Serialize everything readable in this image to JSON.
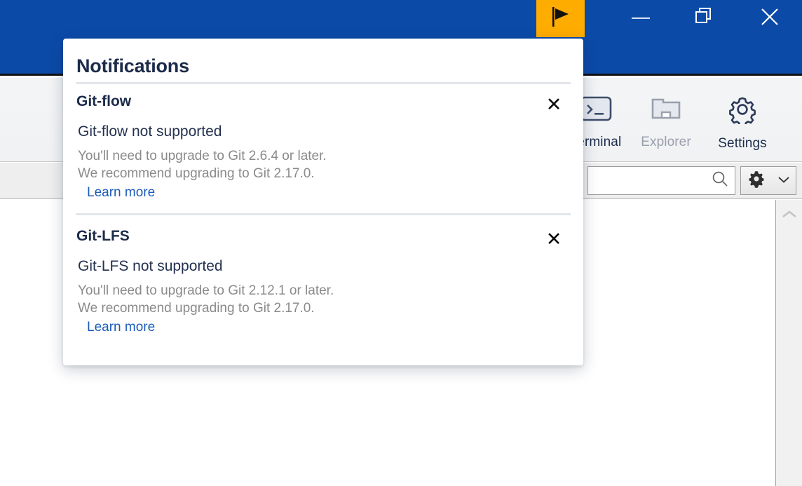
{
  "titlebar": {
    "background": "#0c4aa8",
    "notifications_button": {
      "icon": "flag-icon",
      "background": "#ffac00",
      "label": "Notifications"
    },
    "window_controls": [
      {
        "name": "minimize",
        "icon": "minimize-icon"
      },
      {
        "name": "maximize",
        "icon": "restore-icon"
      },
      {
        "name": "close",
        "icon": "close-icon"
      }
    ]
  },
  "toolbar": {
    "items": [
      {
        "label": "Terminal",
        "icon": "terminal-icon",
        "disabled": false
      },
      {
        "label": "Explorer",
        "icon": "folder-icon",
        "disabled": true
      },
      {
        "label": "Settings",
        "icon": "gear-icon",
        "disabled": false
      }
    ]
  },
  "searchband": {
    "search": {
      "placeholder": "",
      "value": "",
      "icon": "search-icon"
    },
    "settings_dropdown": {
      "icon": "gear-icon",
      "chevron": "chevron-down-icon"
    }
  },
  "scrollbar": {
    "up_arrow": "chevron-up-icon"
  },
  "notifications": {
    "title": "Notifications",
    "close_label": "✕",
    "items": [
      {
        "header": "Git-flow",
        "subject": "Git-flow not supported",
        "line1": "You'll need to upgrade to Git 2.6.4 or later.",
        "line2": "We recommend upgrading to Git 2.17.0.",
        "link": "Learn more"
      },
      {
        "header": "Git-LFS",
        "subject": "Git-LFS not supported",
        "line1": "You'll need to upgrade to Git 2.12.1 or later.",
        "line2": "We recommend upgrading to Git 2.17.0.",
        "link": "Learn more"
      }
    ]
  },
  "colors": {
    "title_bar": "#0c4aa8",
    "accent_orange": "#ffac00",
    "heading_navy": "#1c2b4a",
    "body_gray": "#8a8a8a",
    "link_blue": "#1a5cb8"
  }
}
